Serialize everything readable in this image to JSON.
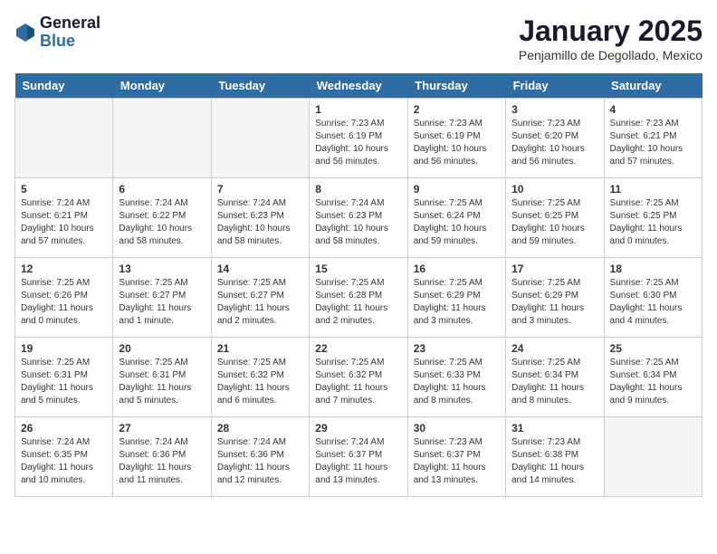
{
  "logo": {
    "general": "General",
    "blue": "Blue"
  },
  "title": "January 2025",
  "subtitle": "Penjamillo de Degollado, Mexico",
  "days": [
    "Sunday",
    "Monday",
    "Tuesday",
    "Wednesday",
    "Thursday",
    "Friday",
    "Saturday"
  ],
  "weeks": [
    [
      {
        "num": "",
        "text": ""
      },
      {
        "num": "",
        "text": ""
      },
      {
        "num": "",
        "text": ""
      },
      {
        "num": "1",
        "text": "Sunrise: 7:23 AM\nSunset: 6:19 PM\nDaylight: 10 hours and 56 minutes."
      },
      {
        "num": "2",
        "text": "Sunrise: 7:23 AM\nSunset: 6:19 PM\nDaylight: 10 hours and 56 minutes."
      },
      {
        "num": "3",
        "text": "Sunrise: 7:23 AM\nSunset: 6:20 PM\nDaylight: 10 hours and 56 minutes."
      },
      {
        "num": "4",
        "text": "Sunrise: 7:23 AM\nSunset: 6:21 PM\nDaylight: 10 hours and 57 minutes."
      }
    ],
    [
      {
        "num": "5",
        "text": "Sunrise: 7:24 AM\nSunset: 6:21 PM\nDaylight: 10 hours and 57 minutes."
      },
      {
        "num": "6",
        "text": "Sunrise: 7:24 AM\nSunset: 6:22 PM\nDaylight: 10 hours and 58 minutes."
      },
      {
        "num": "7",
        "text": "Sunrise: 7:24 AM\nSunset: 6:23 PM\nDaylight: 10 hours and 58 minutes."
      },
      {
        "num": "8",
        "text": "Sunrise: 7:24 AM\nSunset: 6:23 PM\nDaylight: 10 hours and 58 minutes."
      },
      {
        "num": "9",
        "text": "Sunrise: 7:25 AM\nSunset: 6:24 PM\nDaylight: 10 hours and 59 minutes."
      },
      {
        "num": "10",
        "text": "Sunrise: 7:25 AM\nSunset: 6:25 PM\nDaylight: 10 hours and 59 minutes."
      },
      {
        "num": "11",
        "text": "Sunrise: 7:25 AM\nSunset: 6:25 PM\nDaylight: 11 hours and 0 minutes."
      }
    ],
    [
      {
        "num": "12",
        "text": "Sunrise: 7:25 AM\nSunset: 6:26 PM\nDaylight: 11 hours and 0 minutes."
      },
      {
        "num": "13",
        "text": "Sunrise: 7:25 AM\nSunset: 6:27 PM\nDaylight: 11 hours and 1 minute."
      },
      {
        "num": "14",
        "text": "Sunrise: 7:25 AM\nSunset: 6:27 PM\nDaylight: 11 hours and 2 minutes."
      },
      {
        "num": "15",
        "text": "Sunrise: 7:25 AM\nSunset: 6:28 PM\nDaylight: 11 hours and 2 minutes."
      },
      {
        "num": "16",
        "text": "Sunrise: 7:25 AM\nSunset: 6:29 PM\nDaylight: 11 hours and 3 minutes."
      },
      {
        "num": "17",
        "text": "Sunrise: 7:25 AM\nSunset: 6:29 PM\nDaylight: 11 hours and 3 minutes."
      },
      {
        "num": "18",
        "text": "Sunrise: 7:25 AM\nSunset: 6:30 PM\nDaylight: 11 hours and 4 minutes."
      }
    ],
    [
      {
        "num": "19",
        "text": "Sunrise: 7:25 AM\nSunset: 6:31 PM\nDaylight: 11 hours and 5 minutes."
      },
      {
        "num": "20",
        "text": "Sunrise: 7:25 AM\nSunset: 6:31 PM\nDaylight: 11 hours and 5 minutes."
      },
      {
        "num": "21",
        "text": "Sunrise: 7:25 AM\nSunset: 6:32 PM\nDaylight: 11 hours and 6 minutes."
      },
      {
        "num": "22",
        "text": "Sunrise: 7:25 AM\nSunset: 6:32 PM\nDaylight: 11 hours and 7 minutes."
      },
      {
        "num": "23",
        "text": "Sunrise: 7:25 AM\nSunset: 6:33 PM\nDaylight: 11 hours and 8 minutes."
      },
      {
        "num": "24",
        "text": "Sunrise: 7:25 AM\nSunset: 6:34 PM\nDaylight: 11 hours and 8 minutes."
      },
      {
        "num": "25",
        "text": "Sunrise: 7:25 AM\nSunset: 6:34 PM\nDaylight: 11 hours and 9 minutes."
      }
    ],
    [
      {
        "num": "26",
        "text": "Sunrise: 7:24 AM\nSunset: 6:35 PM\nDaylight: 11 hours and 10 minutes."
      },
      {
        "num": "27",
        "text": "Sunrise: 7:24 AM\nSunset: 6:36 PM\nDaylight: 11 hours and 11 minutes."
      },
      {
        "num": "28",
        "text": "Sunrise: 7:24 AM\nSunset: 6:36 PM\nDaylight: 11 hours and 12 minutes."
      },
      {
        "num": "29",
        "text": "Sunrise: 7:24 AM\nSunset: 6:37 PM\nDaylight: 11 hours and 13 minutes."
      },
      {
        "num": "30",
        "text": "Sunrise: 7:23 AM\nSunset: 6:37 PM\nDaylight: 11 hours and 13 minutes."
      },
      {
        "num": "31",
        "text": "Sunrise: 7:23 AM\nSunset: 6:38 PM\nDaylight: 11 hours and 14 minutes."
      },
      {
        "num": "",
        "text": ""
      }
    ]
  ]
}
